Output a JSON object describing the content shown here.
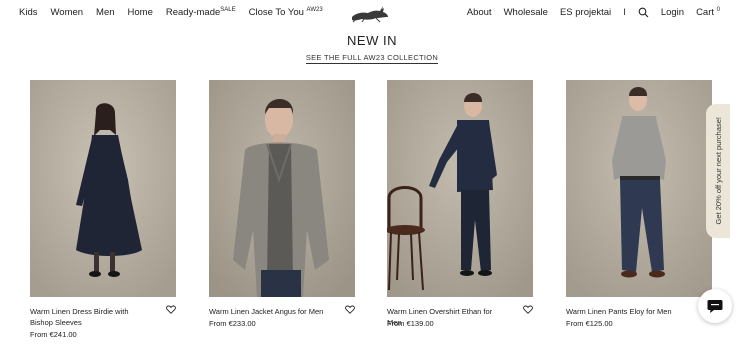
{
  "nav": {
    "left": [
      {
        "label": "Kids"
      },
      {
        "label": "Women"
      },
      {
        "label": "Men"
      },
      {
        "label": "Home"
      },
      {
        "label": "Ready-made",
        "sup": "SALE"
      },
      {
        "label": "Close To You",
        "sup": "AW23"
      }
    ],
    "right": {
      "about": "About",
      "wholesale": "Wholesale",
      "es": "ES projektai",
      "separator": "I",
      "login": "Login",
      "cart": "Cart",
      "cart_count": "0"
    },
    "logo_icon": "hare-logo-icon",
    "search_icon": "search-icon"
  },
  "section": {
    "title": "NEW IN",
    "link": "SEE THE FULL AW23 COLLECTION"
  },
  "products": [
    {
      "name": "Warm Linen Dress Birdie with Bishop Sleeves",
      "price": "From €241.00",
      "favorite": true
    },
    {
      "name": "Warm Linen Jacket Angus for Men",
      "price": "From €233.00",
      "favorite": true
    },
    {
      "name": "Warm Linen Overshirt Ethan for Men",
      "price": "From €139.00",
      "favorite": true
    },
    {
      "name": "Warm Linen Pants Eloy for Men",
      "price": "From €125.00",
      "favorite": false
    }
  ],
  "promo": {
    "label": "Get 20% off your next purchase!"
  },
  "chat": {
    "icon": "chat-bubble-icon"
  },
  "colors": {
    "background": "#ffffff",
    "photo_backdrop": "#b9b2a5",
    "promo_tab": "#ece6d9",
    "text": "#222222"
  }
}
